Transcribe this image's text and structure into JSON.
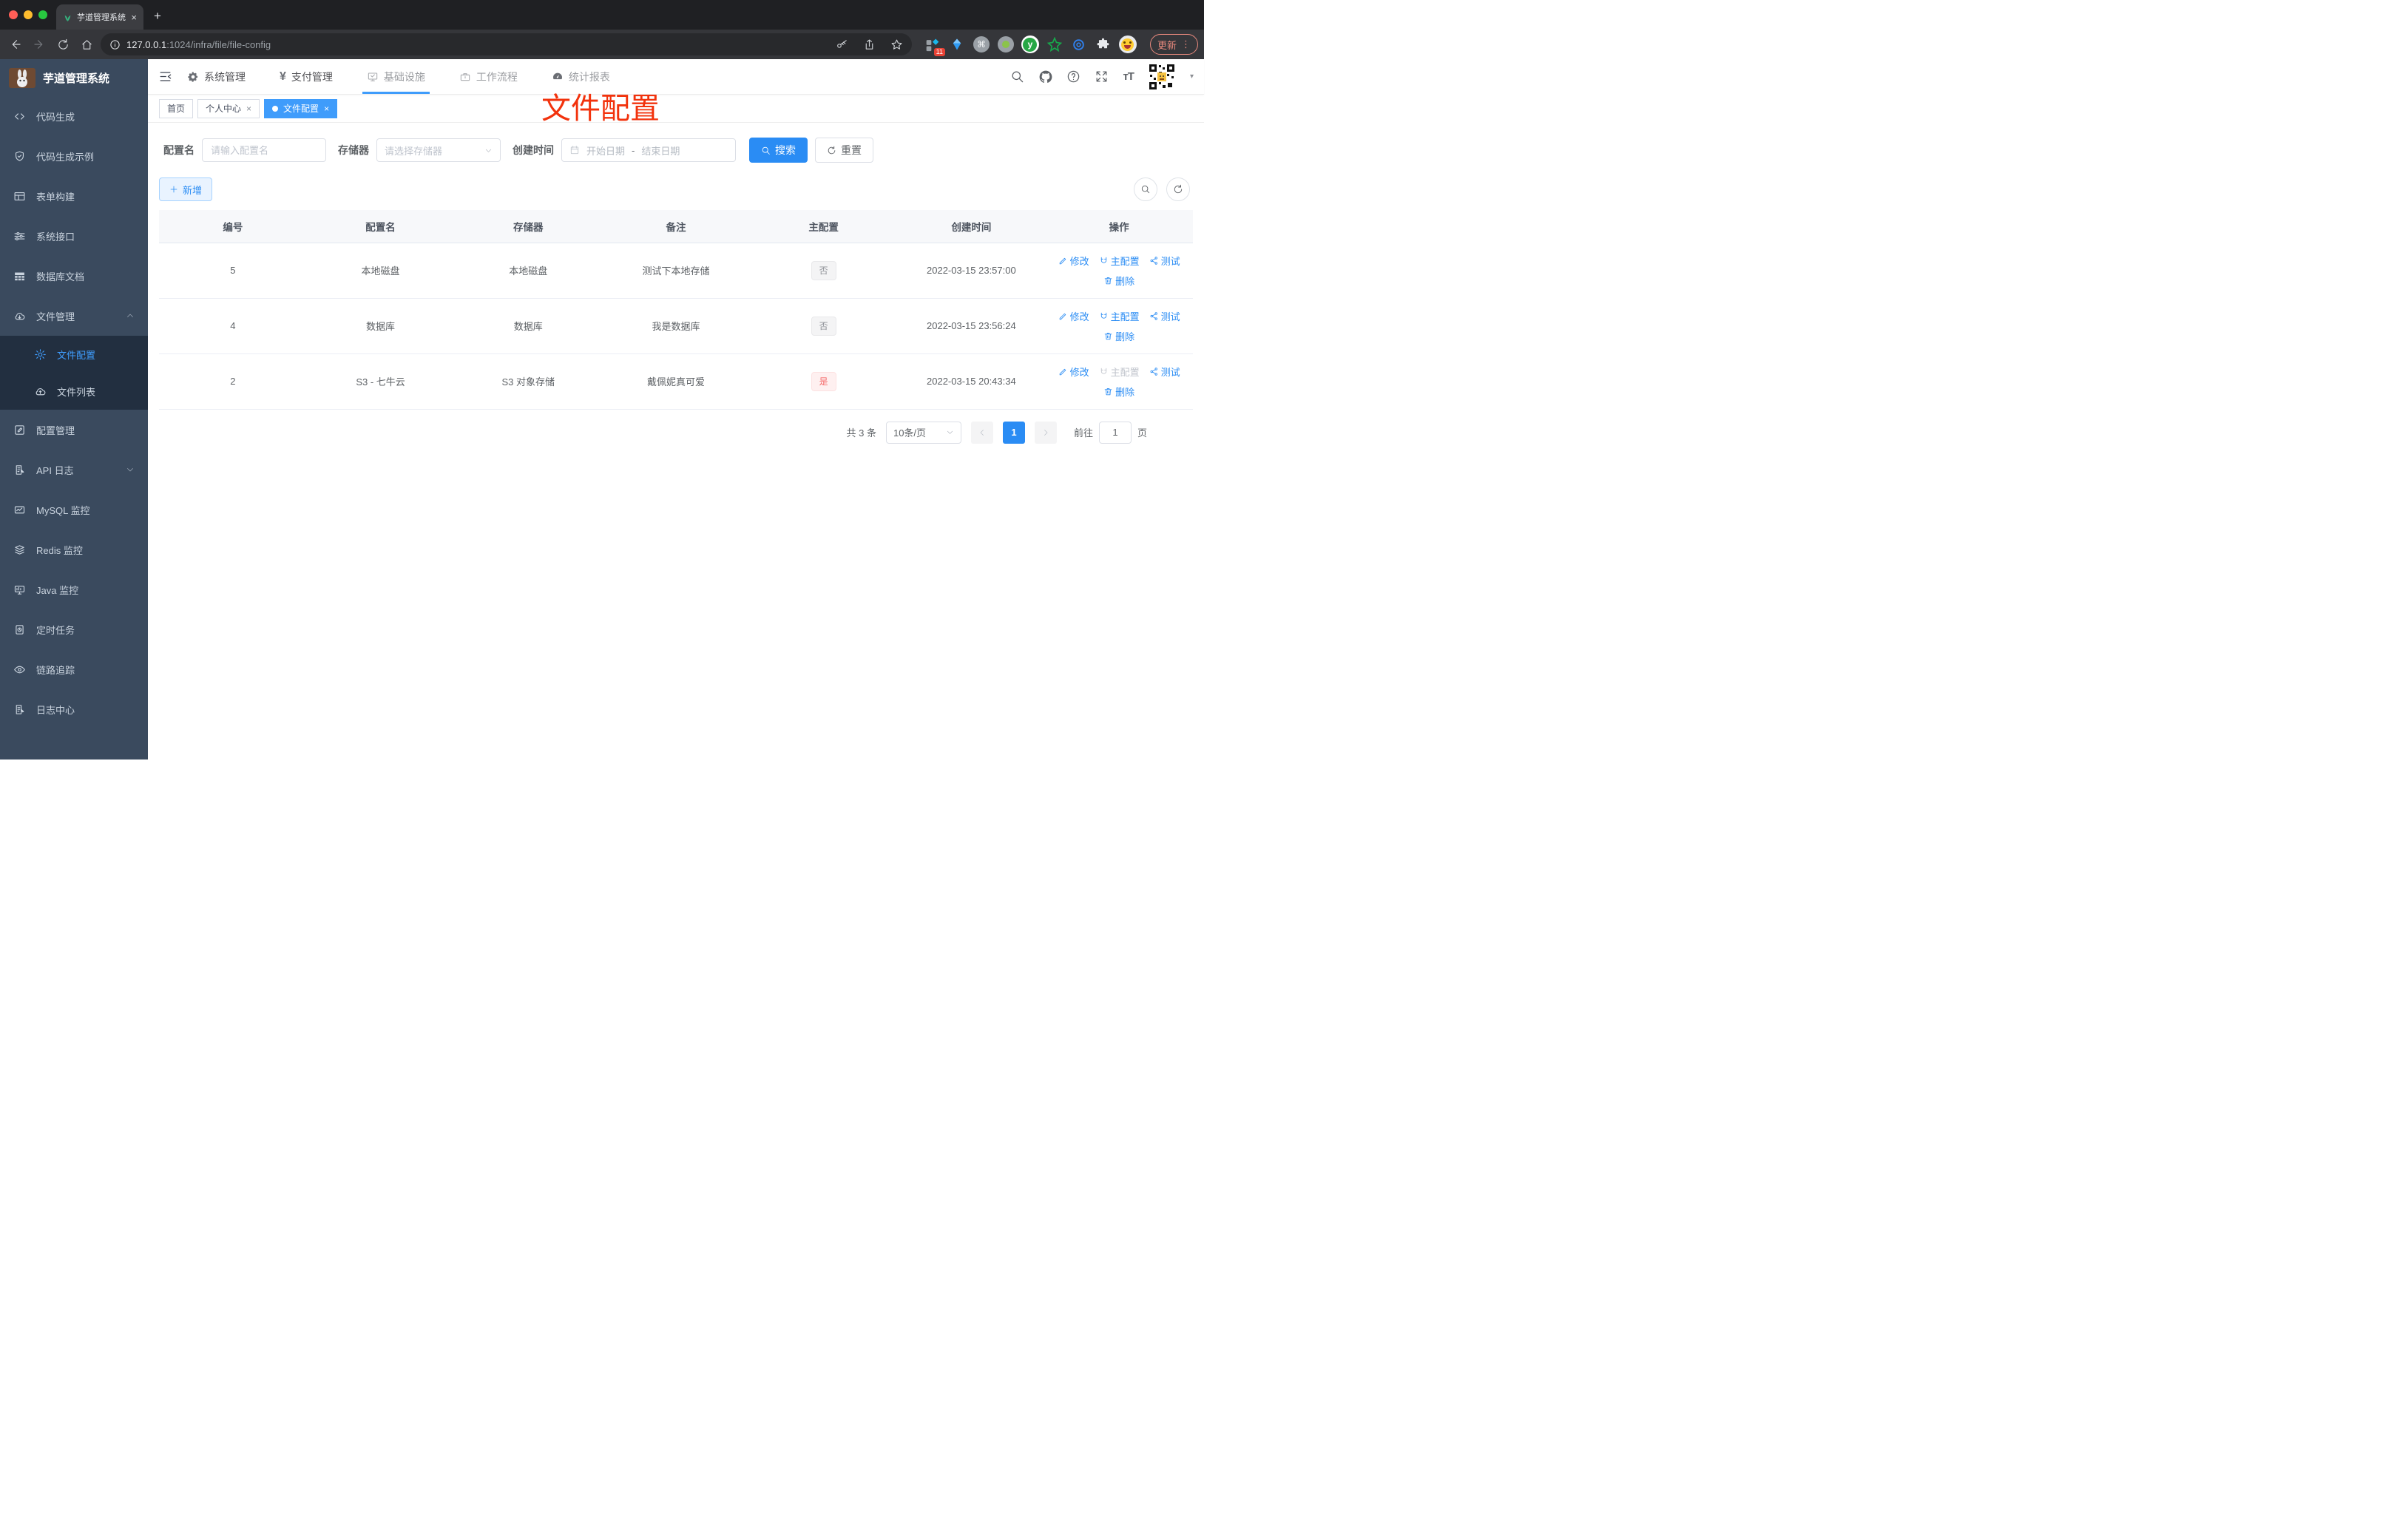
{
  "browser": {
    "tab_title": "芋道管理系统",
    "url_host": "127.0.0.1",
    "url_path": ":1024/infra/file/file-config",
    "update_label": "更新",
    "extension_badge": "11",
    "cmd_glyph": "⌘",
    "y_glyph": "y",
    "new_tab_glyph": "+",
    "close_glyph": "×",
    "menu_dots": "⋮"
  },
  "sidebar": {
    "title": "芋道管理系统",
    "items": [
      {
        "label": "代码生成"
      },
      {
        "label": "代码生成示例"
      },
      {
        "label": "表单构建"
      },
      {
        "label": "系统接口"
      },
      {
        "label": "数据库文档"
      },
      {
        "label": "文件管理"
      },
      {
        "label": "文件配置"
      },
      {
        "label": "文件列表"
      },
      {
        "label": "配置管理"
      },
      {
        "label": "API 日志"
      },
      {
        "label": "MySQL 监控"
      },
      {
        "label": "Redis 监控"
      },
      {
        "label": "Java 监控"
      },
      {
        "label": "定时任务"
      },
      {
        "label": "链路追踪"
      },
      {
        "label": "日志中心"
      }
    ]
  },
  "header": {
    "nav": [
      {
        "label": "系统管理"
      },
      {
        "label": "支付管理"
      },
      {
        "label": "基础设施"
      },
      {
        "label": "工作流程"
      },
      {
        "label": "统计报表"
      }
    ],
    "yen_glyph": "¥",
    "font_size_glyph": "тT",
    "caret_glyph": "▾"
  },
  "tags": [
    {
      "label": "首页"
    },
    {
      "label": "个人中心"
    },
    {
      "label": "文件配置"
    }
  ],
  "annotation": {
    "text": "文件配置",
    "color": "#f2320c"
  },
  "filters": {
    "name_label": "配置名",
    "name_placeholder": "请输入配置名",
    "storage_label": "存储器",
    "storage_placeholder": "请选择存储器",
    "time_label": "创建时间",
    "start_placeholder": "开始日期",
    "range_separator": "-",
    "end_placeholder": "结束日期",
    "search_label": "搜索",
    "reset_label": "重置",
    "add_label": "新增"
  },
  "table": {
    "headers": [
      "编号",
      "配置名",
      "存储器",
      "备注",
      "主配置",
      "创建时间",
      "操作"
    ],
    "actions": {
      "edit": "修改",
      "master": "主配置",
      "test": "测试",
      "delete": "删除"
    },
    "rows": [
      {
        "id": "5",
        "name": "本地磁盘",
        "storage": "本地磁盘",
        "remark": "测试下本地存储",
        "primary": "否",
        "created": "2022-03-15 23:57:00"
      },
      {
        "id": "4",
        "name": "数据库",
        "storage": "数据库",
        "remark": "我是数据库",
        "primary": "否",
        "created": "2022-03-15 23:56:24"
      },
      {
        "id": "2",
        "name": "S3 - 七牛云",
        "storage": "S3 对象存储",
        "remark": "戴佩妮真可爱",
        "primary": "是",
        "created": "2022-03-15 20:43:34"
      }
    ]
  },
  "pagination": {
    "total": "共 3 条",
    "page_size": "10条/页",
    "current": "1",
    "goto_label": "前往",
    "goto_value": "1",
    "unit_label": "页"
  },
  "colors": {
    "accent": "#409EFF",
    "sidebar": "#3a4a5e",
    "submenu": "#222f40",
    "danger": "#f56c6c"
  }
}
